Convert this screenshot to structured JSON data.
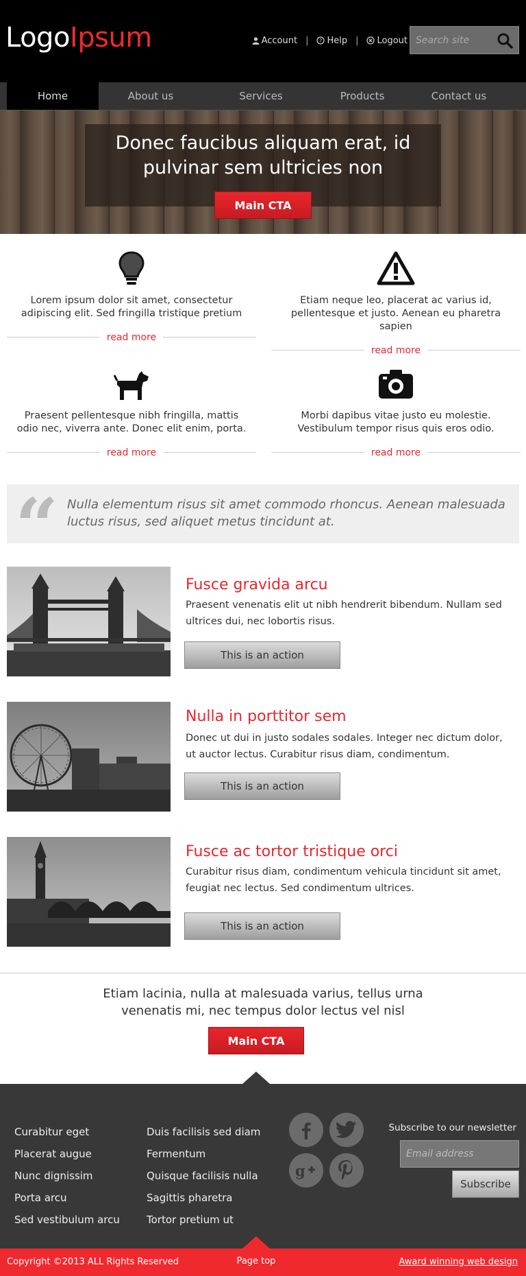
{
  "header": {
    "logo_part1": "Logo",
    "logo_part2": "Ipsum",
    "links": {
      "account": "Account",
      "help": "Help",
      "logout": "Logout"
    },
    "separator": "|",
    "search_placeholder": "Search site"
  },
  "nav": {
    "items": [
      "Home",
      "About us",
      "Services",
      "Products",
      "Contact us"
    ],
    "active": "Home"
  },
  "hero": {
    "title_line1": "Donec faucibus aliquam erat, id",
    "title_line2": "pulvinar sem ultricies non",
    "cta": "Main CTA"
  },
  "features": [
    {
      "icon": "lightbulb-icon",
      "text": "Lorem ipsum dolor sit amet, consectetur adipiscing elit. Sed fringilla tristique pretium",
      "link": "read more"
    },
    {
      "icon": "warning-icon",
      "text": "Etiam neque leo, placerat ac varius id, pellentesque et justo. Aenean eu pharetra sapien",
      "link": "read more"
    },
    {
      "icon": "dog-icon",
      "text": "Praesent pellentesque nibh fringilla, mattis odio nec, viverra ante. Donec elit enim, porta.",
      "link": "read more"
    },
    {
      "icon": "camera-icon",
      "text": "Morbi dapibus vitae justo eu molestie. Vestibulum tempor risus quis eros odio.",
      "link": "read more"
    }
  ],
  "quote": {
    "text": "Nulla elementum risus sit amet commodo rhoncus. Aenean malesuada luctus risus, sed aliquet metus tincidunt at."
  },
  "articles": [
    {
      "title": "Fusce gravida arcu",
      "text": "Praesent venenatis elit ut nibh hendrerit bibendum. Nullam sed ultrices dui, nec lobortis risus.",
      "button": "This is an action"
    },
    {
      "title": "Nulla in porttitor sem",
      "text": "Donec ut dui in justo sodales sodales. Integer nec dictum dolor, ut auctor lectus. Curabitur risus diam, condimentum.",
      "button": "This is an action"
    },
    {
      "title": "Fusce ac tortor tristique orci",
      "text": "Curabitur risus diam, condimentum vehicula tincidunt sit amet, feugiat nec lectus. Sed condimentum ultrices.",
      "button": "This is an action"
    }
  ],
  "bottom": {
    "text": "Etiam lacinia, nulla at malesuada varius, tellus urna venenatis mi, nec tempus dolor lectus vel nisl",
    "cta": "Main CTA"
  },
  "footer": {
    "col1": [
      "Curabitur eget",
      "Placerat augue",
      "Nunc dignissim",
      "Porta arcu",
      "Sed vestibulum arcu"
    ],
    "col2": [
      "Duis facilisis sed diam",
      "Fermentum",
      "Quisque facilisis nulla",
      "Sagittis pharetra",
      "Tortor pretium ut"
    ],
    "social": [
      "facebook-icon",
      "twitter-icon",
      "google-plus-icon",
      "pinterest-icon"
    ],
    "newsletter_label": "Subscribe to our newsletter",
    "email_placeholder": "Email address",
    "subscribe": "Subscribe"
  },
  "copyright_bar": {
    "copyright": "Copyright  ©2013 ALL Rights Reserved",
    "page_top": "Page top",
    "award": "Award winning web design"
  },
  "colors": {
    "accent": "#f0292f",
    "header_bg": "#000000",
    "nav_bg": "#343434",
    "footer_bg": "#383838"
  }
}
